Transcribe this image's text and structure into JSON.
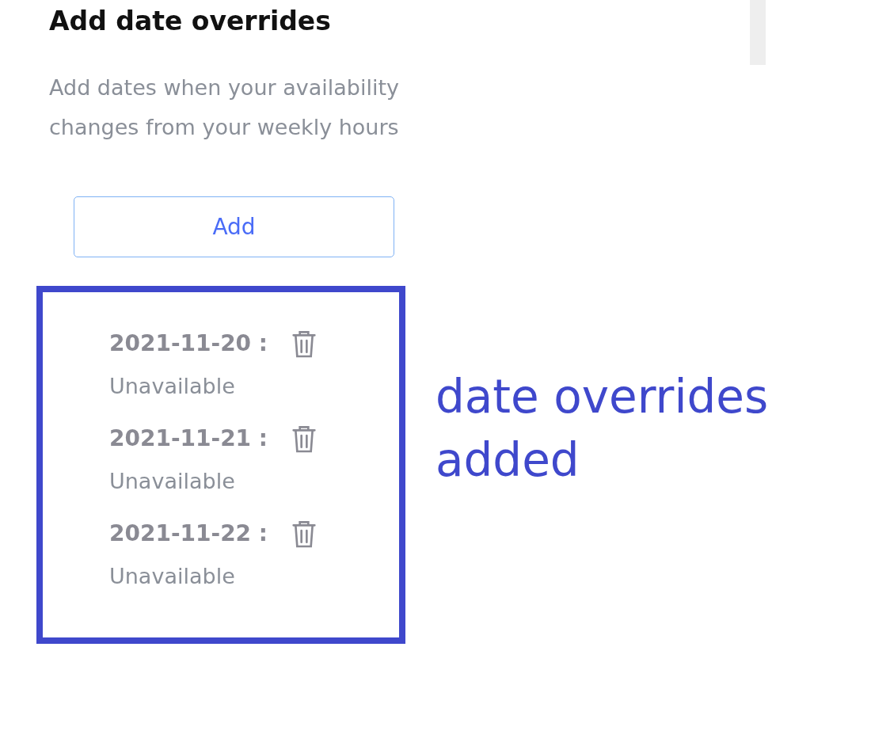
{
  "heading": "Add date overrides",
  "description": "Add dates when your availability changes from your weekly hours",
  "add_button": "Add",
  "overrides": [
    {
      "date": "2021-11-20 :",
      "status": "Unavailable"
    },
    {
      "date": "2021-11-21 :",
      "status": "Unavailable"
    },
    {
      "date": "2021-11-22 :",
      "status": "Unavailable"
    }
  ],
  "annotation": "date overrides added"
}
